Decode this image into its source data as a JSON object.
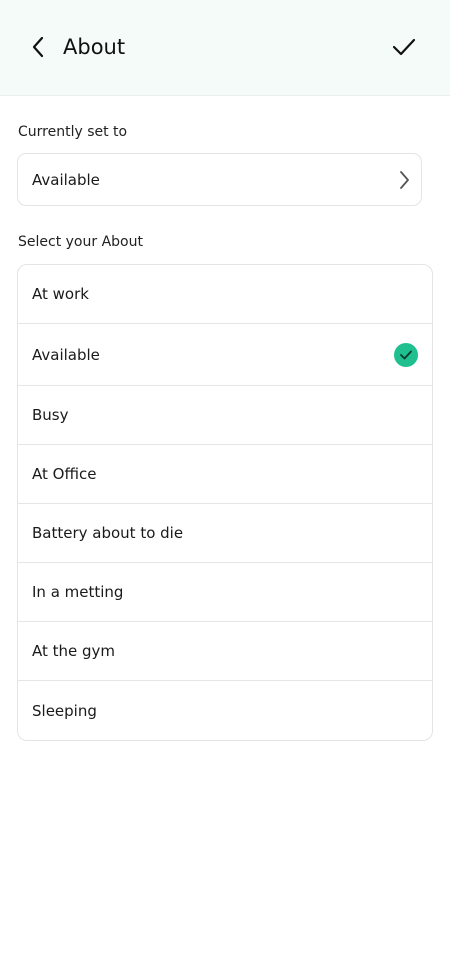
{
  "header": {
    "title": "About",
    "back_icon": "chevron-left-icon",
    "confirm_icon": "checkmark-icon"
  },
  "current": {
    "label": "Currently set to",
    "value": "Available",
    "chevron_icon": "chevron-right-icon"
  },
  "select": {
    "label": "Select your About",
    "options": [
      {
        "label": "At work",
        "selected": false
      },
      {
        "label": "Available",
        "selected": true
      },
      {
        "label": "Busy",
        "selected": false
      },
      {
        "label": "At Office",
        "selected": false
      },
      {
        "label": "Battery about to die",
        "selected": false
      },
      {
        "label": "In a metting",
        "selected": false
      },
      {
        "label": "At the gym",
        "selected": false
      },
      {
        "label": "Sleeping",
        "selected": false
      }
    ]
  },
  "colors": {
    "header_bg": "#f4fbf9",
    "accent": "#1fbf8f"
  }
}
